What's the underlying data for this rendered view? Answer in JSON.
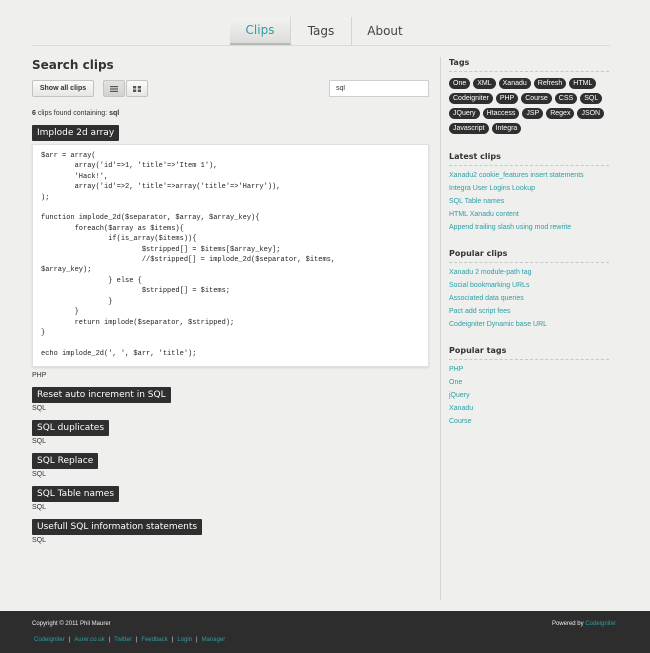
{
  "nav": {
    "tabs": [
      {
        "label": "Clips",
        "active": true
      },
      {
        "label": "Tags",
        "active": false
      },
      {
        "label": "About",
        "active": false
      }
    ]
  },
  "main": {
    "title": "Search clips",
    "show_all_label": "Show all clips",
    "search_value": "sql",
    "found": {
      "count": "6",
      "text": "clips found containing:",
      "term": "sql"
    },
    "clips": [
      {
        "title": "Implode 2d array",
        "lang": "PHP",
        "code": "$arr = array(\n        array('id'=>1, 'title'=>'Item 1'),\n        'Hack!',\n        array('id'=>2, 'title'=>array('title'=>'Harry')),\n);\n\nfunction implode_2d($separator, $array, $array_key){\n        foreach($array as $items){\n                if(is_array($items)){\n                        $stripped[] = $items[$array_key];\n                        //$stripped[] = implode_2d($separator, $items,\n$array_key);\n                } else {\n                        $stripped[] = $items;\n                }\n        }\n        return implode($separator, $stripped);\n}\n\necho implode_2d(', ', $arr, 'title');"
      },
      {
        "title": "Reset auto increment in SQL",
        "lang": "SQL"
      },
      {
        "title": "SQL duplicates",
        "lang": "SQL"
      },
      {
        "title": "SQL Replace",
        "lang": "SQL"
      },
      {
        "title": "SQL Table names",
        "lang": "SQL"
      },
      {
        "title": "Usefull SQL information statements",
        "lang": "SQL"
      }
    ]
  },
  "sidebar": {
    "tags_heading": "Tags",
    "tags": [
      "One",
      "XML",
      "Xanadu",
      "Refresh",
      "HTML",
      "Codeigniter",
      "PHP",
      "Course",
      "CSS",
      "SQL",
      "JQuery",
      "Htaccess",
      "JSP",
      "Regex",
      "JSON",
      "Javascript",
      "Integra"
    ],
    "latest_heading": "Latest clips",
    "latest": [
      "Xanadu2 cookie_features insert statements",
      "Integra User Logins Lookup",
      "SQL Table names",
      "HTML Xanadu content",
      "Append trailing slash using mod rewrite"
    ],
    "popular_clips_heading": "Popular clips",
    "popular_clips": [
      "Xanadu 2 module-path tag",
      "Social bookmarking URLs",
      "Associated data queries",
      "Pact add script fees",
      "Codeigniter Dynamic base URL"
    ],
    "popular_tags_heading": "Popular tags",
    "popular_tags": [
      "PHP",
      "One",
      "jQuery",
      "Xanadu",
      "Course"
    ]
  },
  "footer": {
    "copyright": "Copyright © 2011 Phil Maurer",
    "powered_prefix": "Powered by",
    "powered_link": "Codeigniter",
    "links": [
      "Codeigniter",
      "Aurer.co.uk",
      "Twitter",
      "Feedback",
      "Login",
      "Manager"
    ],
    "separator": "|"
  },
  "colors": {
    "accent": "#2a9fa6",
    "dark": "#2f2f2f",
    "background": "#efefed"
  },
  "icons": {
    "list_view": "list-view-icon",
    "grid_view": "grid-view-icon"
  }
}
